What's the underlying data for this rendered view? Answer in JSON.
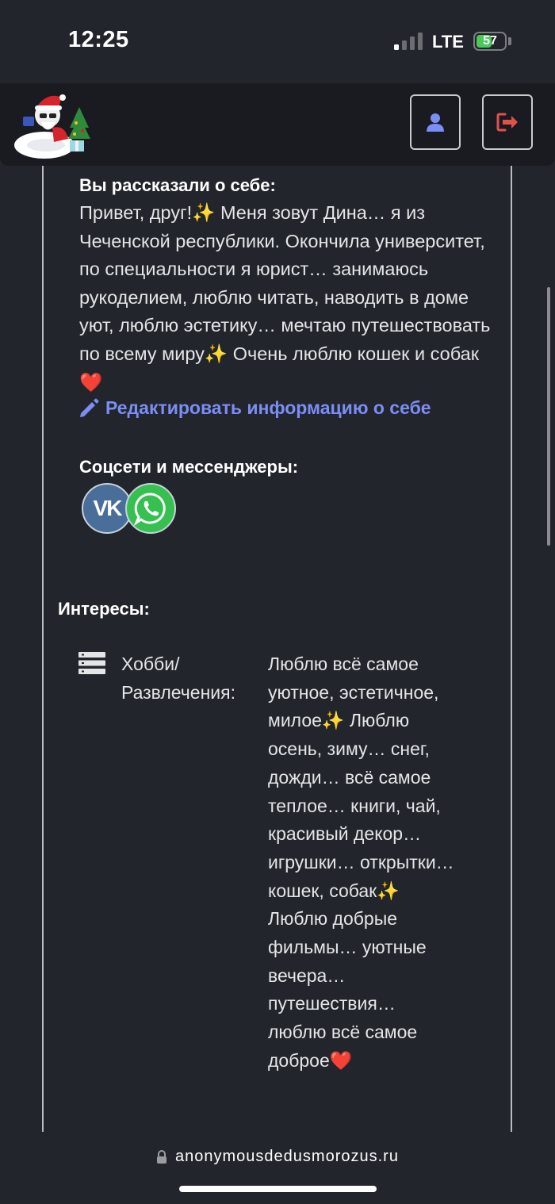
{
  "status": {
    "time": "12:25",
    "network": "LTE",
    "battery": "57",
    "battery_level": 0.57
  },
  "header": {
    "logo_icon": "santa-snake-logo",
    "profile_icon": "user-icon",
    "logout_icon": "logout-icon"
  },
  "about": {
    "title": "Вы рассказали о себе:",
    "text": "Привет, друг!✨ Меня зовут Дина… я из Чеченской республики. Окончила университет, по специальности я юрист… занимаюсь рукоделием, люблю читать, наводить в доме уют, люблю эстетику… мечтаю путешествовать по всему миру✨ Очень люблю кошек и собак❤️",
    "edit_link": "Редактировать информацию о себе"
  },
  "socials": {
    "title": "Соцсети и мессенджеры:",
    "items": [
      "vk-icon",
      "whatsapp-icon"
    ]
  },
  "interests": {
    "title": "Интересы:",
    "hobby_label": "Хобби/ Развлечения:",
    "hobby_value": "Люблю всё самое уютное, эстетичное, милое✨ Люблю осень, зиму… снег, дожди… всё самое теплое… книги, чай, красивый декор… игрушки… открытки… кошек, собак✨ Люблю добрые фильмы… уютные вечера… путешествия… люблю всё самое доброе❤️"
  },
  "browser": {
    "url": "anonymousdedusmorozus.ru"
  },
  "colors": {
    "background": "#22252b",
    "header": "#191b20",
    "link": "#7b8ef5",
    "vk": "#4a6e9a",
    "whatsapp": "#35c04f",
    "logout_red": "#e0524a",
    "profile_blue": "#7b8ef5"
  }
}
